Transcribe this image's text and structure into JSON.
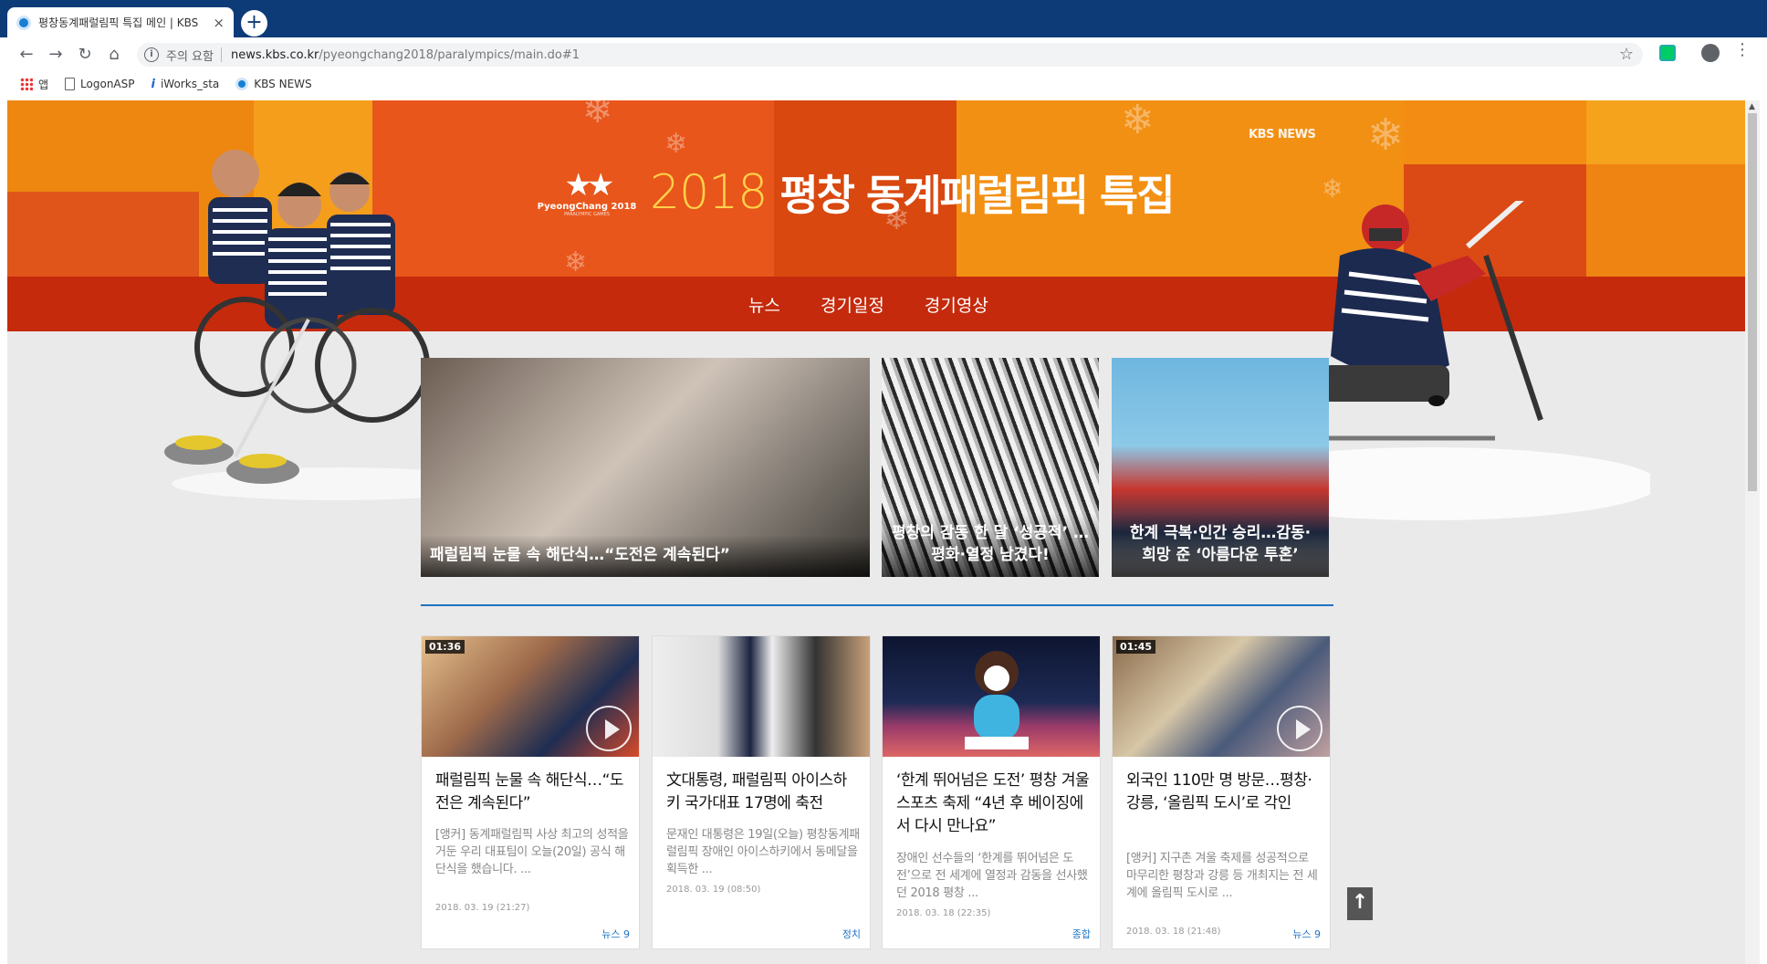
{
  "browser": {
    "tab_title": "평창동계패럴림픽 특집 메인 | KBS",
    "new_tab": "+",
    "tab_close": "×",
    "security_label": "주의 요함",
    "url_host": "news.kbs.co.kr",
    "url_path": "/pyeongchang2018/paralympics/main.do#1",
    "bookmarks": [
      "앱",
      "LogonASP",
      "iWorks_sta",
      "KBS NEWS"
    ]
  },
  "banner": {
    "emblem_stars": "★★",
    "emblem_name": "PyeongChang 2018",
    "emblem_sub": "PARALYMPIC GAMES",
    "title_year": "2018",
    "title_text": "평창 동계패럴림픽 특집",
    "kbs_logo": "KBS NEWS",
    "nav": [
      "뉴스",
      "경기일정",
      "경기영상"
    ]
  },
  "featured": [
    {
      "caption": "패럴림픽 눈물 속 해단식…“도전은 계속된다”"
    },
    {
      "caption": "평창의 감동 한 달 ‘성공적’ …평화·열정 남겼다!"
    },
    {
      "caption": "한계 극복·인간 승리…감동· 희망 준 ‘아름다운 투혼’"
    }
  ],
  "cards": [
    {
      "duration": "01:36",
      "title": "패럴림픽 눈물 속 해단식…“도전은 계속된다”",
      "summary": "[앵커] 동계패럴림픽 사상 최고의 성적을 거둔 우리 대표팀이 오늘(20일) 공식 해단식을 했습니다. ...",
      "date": "2018. 03. 19 (21:27)",
      "category": "뉴스 9"
    },
    {
      "duration": "",
      "title": "文대통령, 패럴림픽 아이스하키 국가대표 17명에 축전",
      "summary": "문재인 대통령은 19일(오늘) 평창동계패럴림픽 장애인 아이스하키에서 동메달을 획득한 ...",
      "date": "2018. 03. 19 (08:50)",
      "category": "정치"
    },
    {
      "duration": "",
      "title": "‘한계 뛰어넘은 도전’ 평창 겨울스포츠 축제 “4년 후 베이징에서 다시 만나요”",
      "summary": "장애인 선수들의 ‘한계를 뛰어넘은 도전’으로 전 세계에 열정과 감동을 선사했던 2018 평창 ...",
      "date": "2018. 03. 18 (22:35)",
      "category": "종합"
    },
    {
      "duration": "01:45",
      "title": "외국인 110만 명 방문…평창·강릉, ‘올림픽 도시’로 각인",
      "summary": "[앵커] 지구촌 겨울 축제를 성공적으로 마무리한 평창과 강릉 등 개최지는 전 세계에 올림픽 도시로 ...",
      "date": "2018. 03. 18 (21:48)",
      "category": "뉴스 9"
    }
  ],
  "top_button": "↑"
}
